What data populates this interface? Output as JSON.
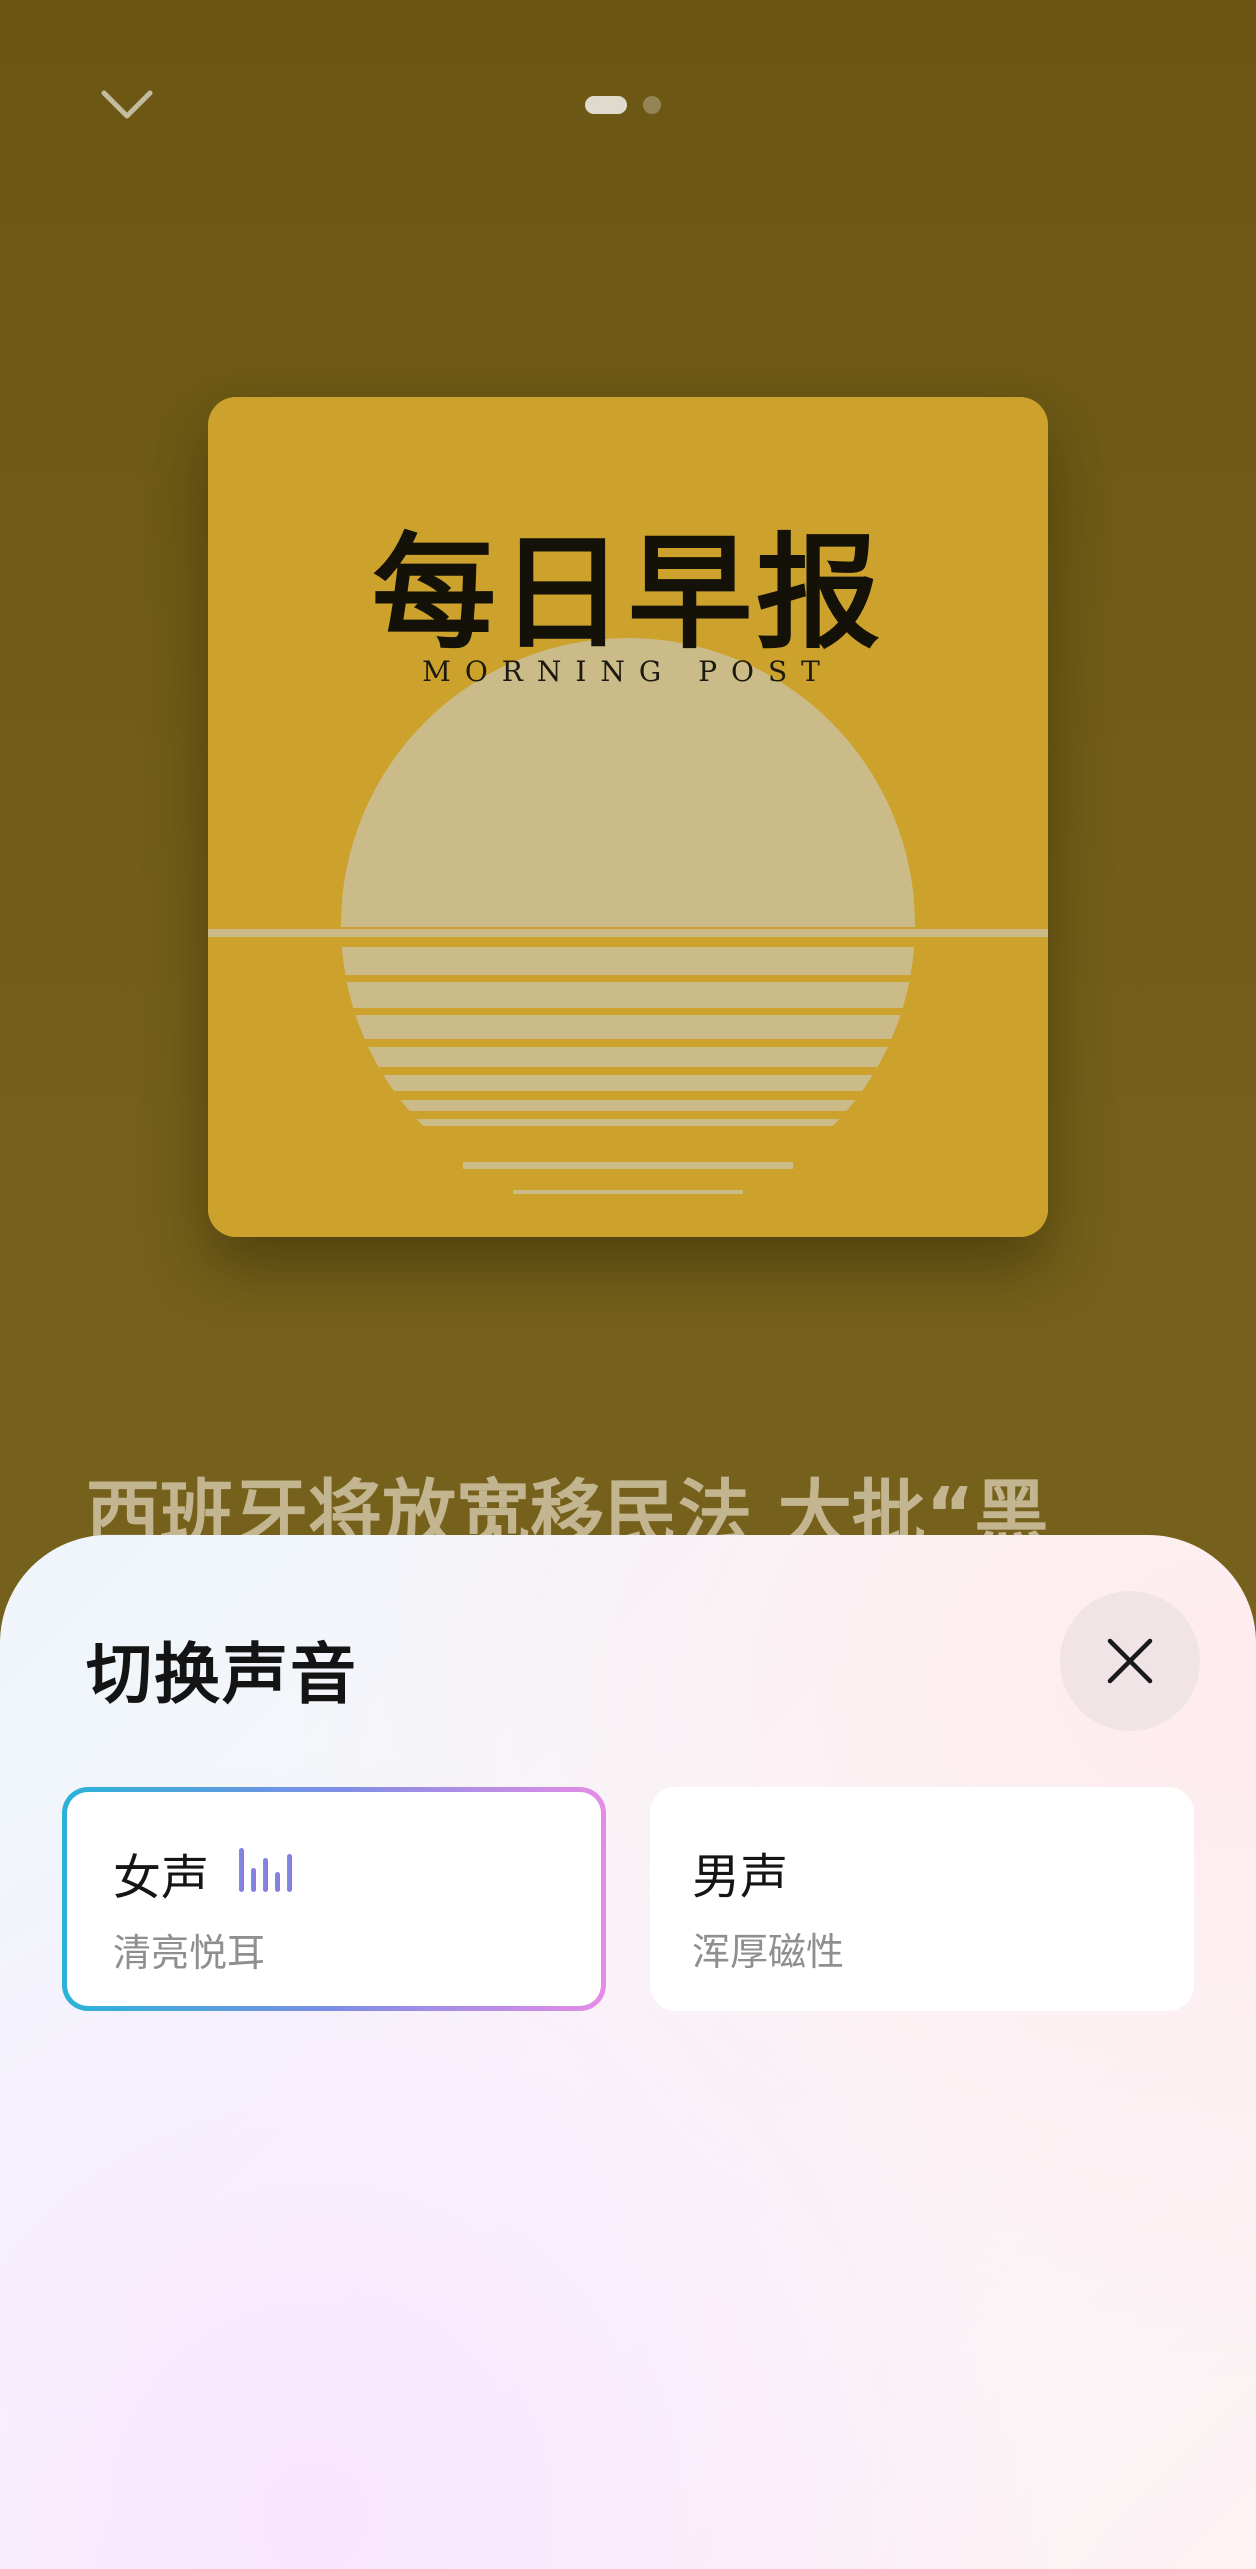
{
  "topbar": {
    "collapse_icon": "chevron-down-icon",
    "pager": {
      "total": 2,
      "active": 1
    }
  },
  "cover": {
    "title": "每日早报",
    "subtitle": "MORNING POST",
    "background_color": "#cca22c"
  },
  "episode": {
    "title": "西班牙将放宽移民法 大批“黑"
  },
  "voice_sheet": {
    "title": "切换声音",
    "close_icon": "close-icon",
    "options": [
      {
        "name": "女声",
        "description": "清亮悦耳",
        "selected": true,
        "indicator_icon": "audio-bars-icon"
      },
      {
        "name": "男声",
        "description": "浑厚磁性",
        "selected": false
      }
    ]
  }
}
